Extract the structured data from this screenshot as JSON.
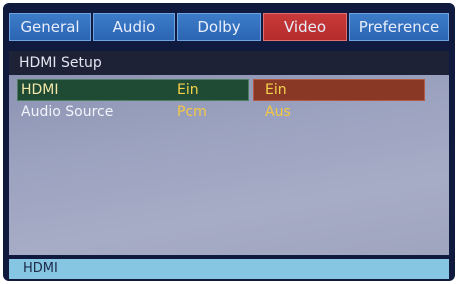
{
  "tabs": [
    {
      "label": "General"
    },
    {
      "label": "Audio"
    },
    {
      "label": "Dolby"
    },
    {
      "label": "Video"
    },
    {
      "label": "Preference"
    }
  ],
  "active_tab": "Video",
  "section": {
    "title": "HDMI Setup"
  },
  "rows": [
    {
      "label": "HDMI",
      "value": "Ein",
      "option": "Ein"
    },
    {
      "label": "Audio Source",
      "value": "Pcm",
      "option": "Aus"
    }
  ],
  "status": {
    "text": "HDMI"
  },
  "colors": {
    "tab": "#2b65b3",
    "tab_active": "#b52c2c",
    "selected_row": "#1f4a33",
    "selected_option": "#8a3826",
    "value_text": "#f5c842",
    "status_bar": "#86c6e2"
  }
}
